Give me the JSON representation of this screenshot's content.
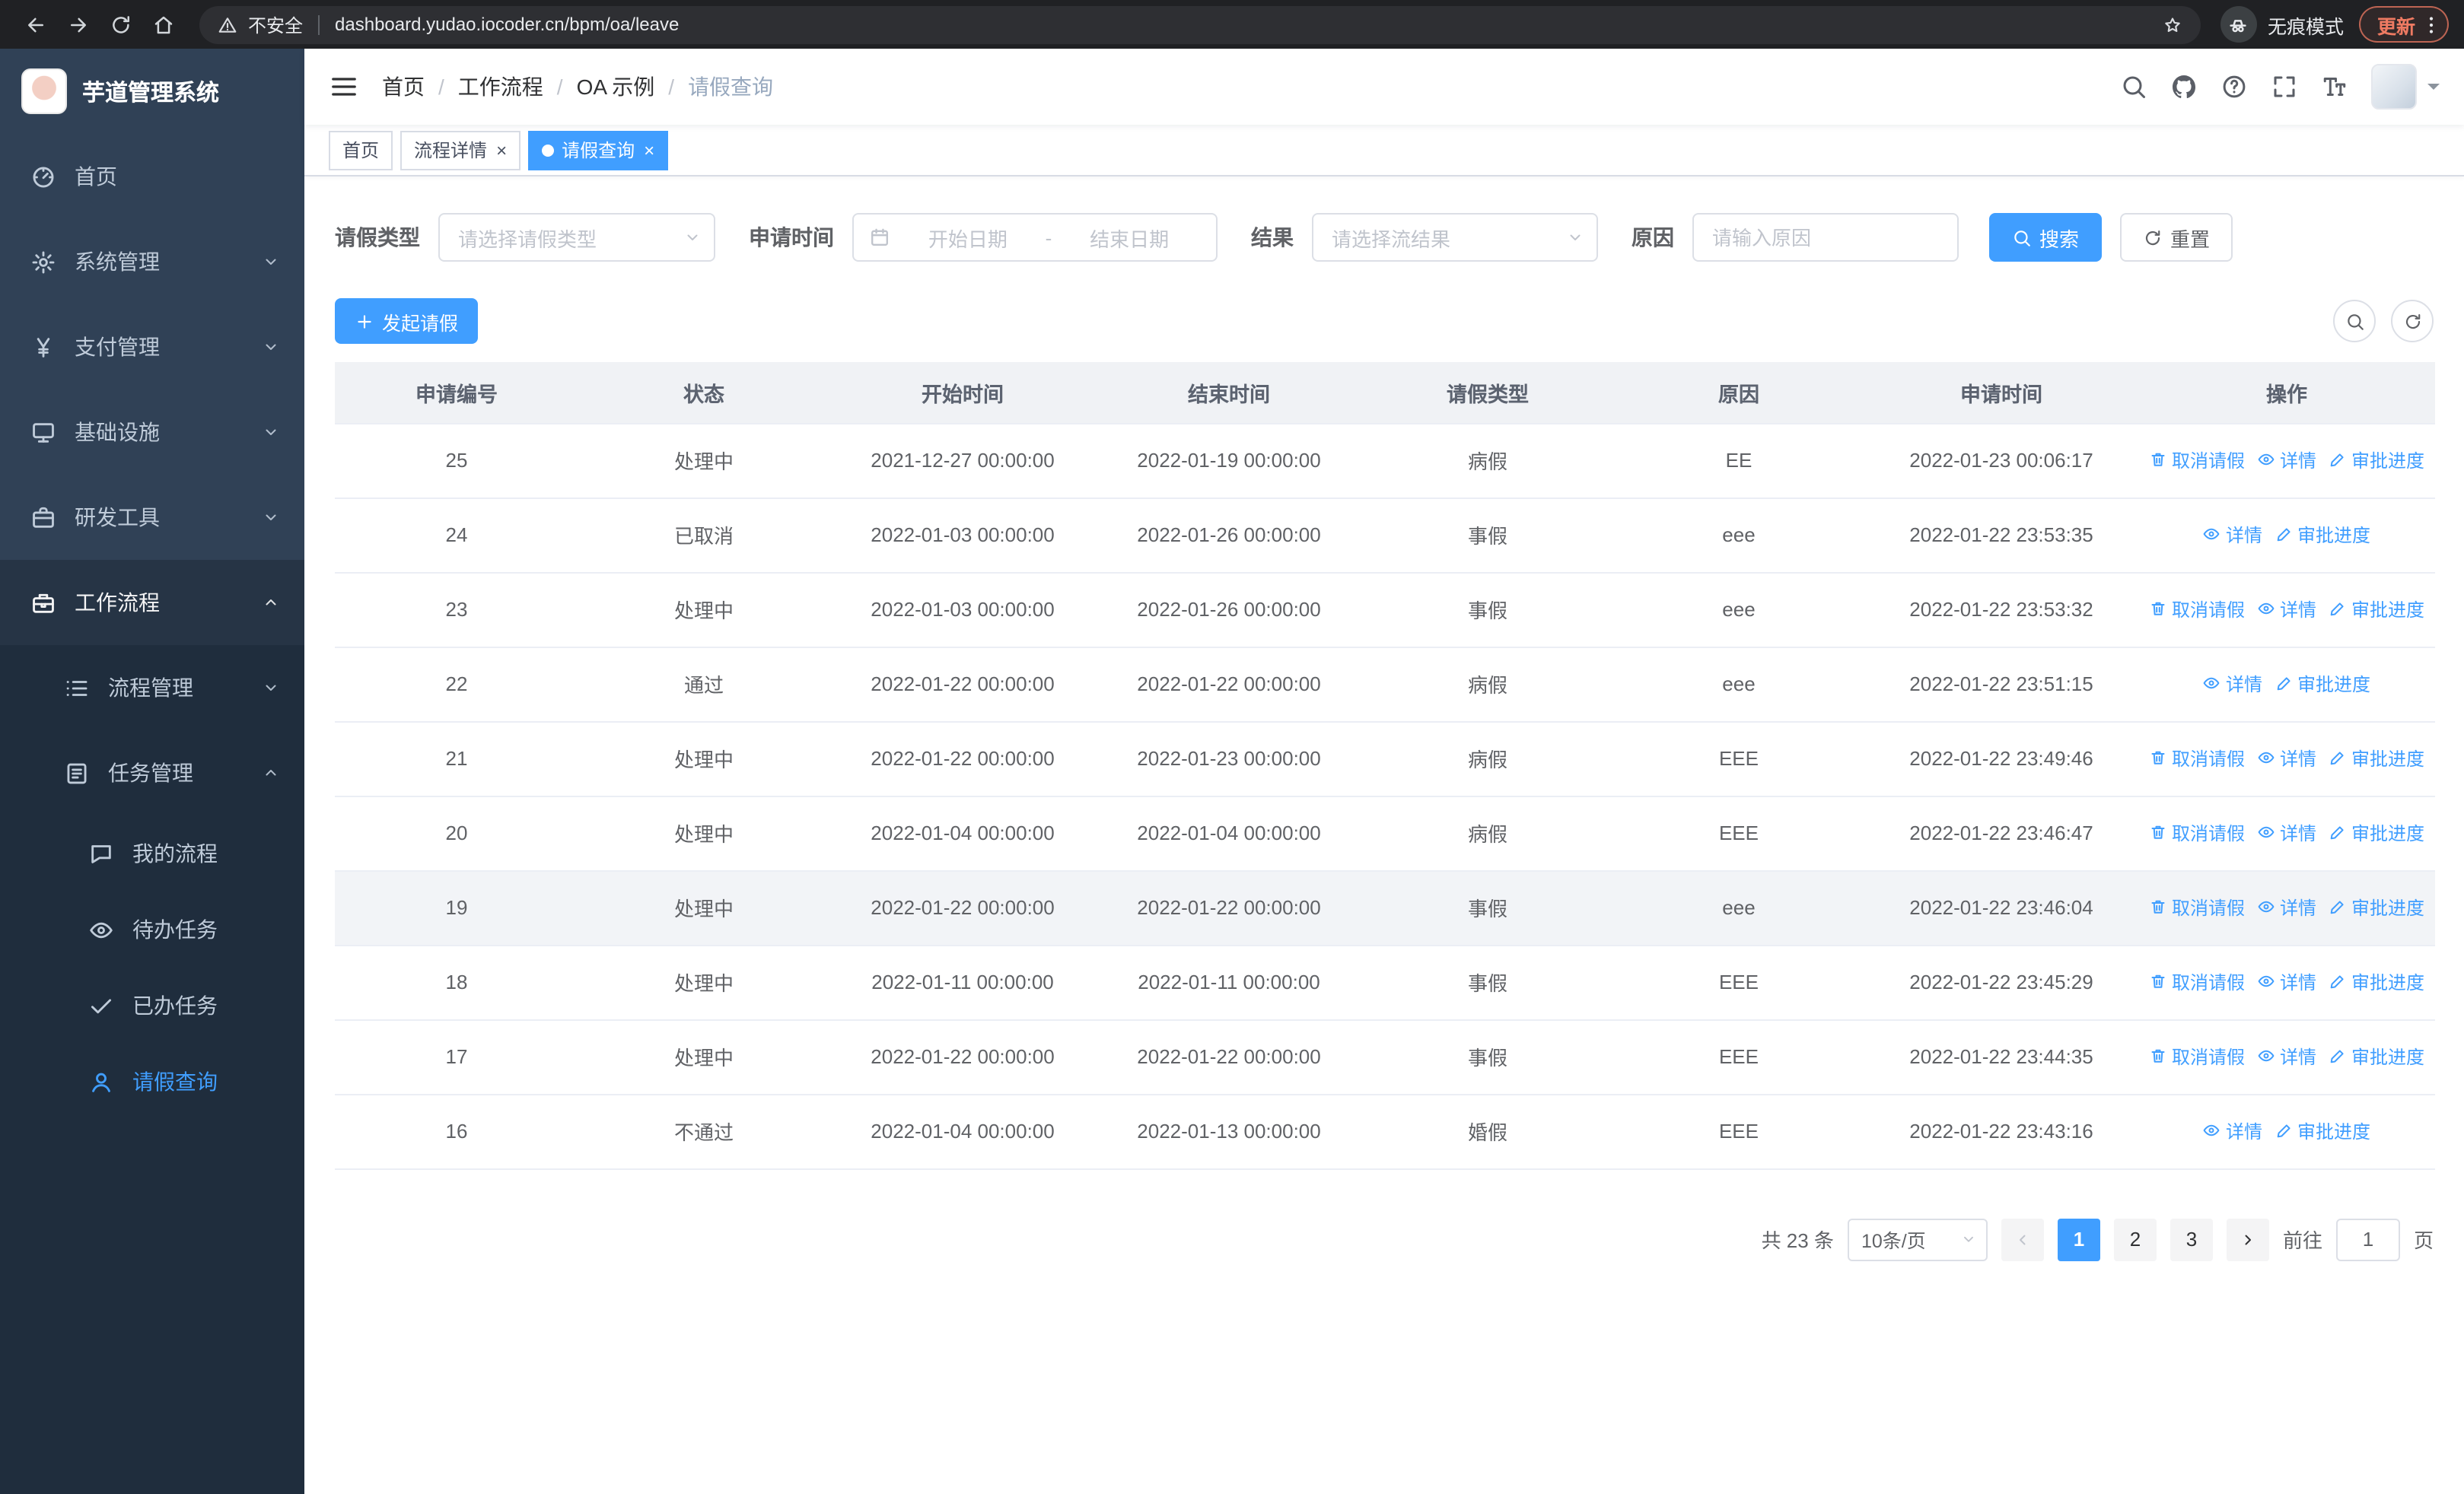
{
  "browser": {
    "security_warning": "不安全",
    "url": "dashboard.yudao.iocoder.cn/bpm/oa/leave",
    "incognito_label": "无痕模式",
    "update_label": "更新"
  },
  "header": {
    "breadcrumb": [
      "首页",
      "工作流程",
      "OA 示例",
      "请假查询"
    ],
    "icons": [
      "search-icon",
      "github-icon",
      "help-icon",
      "fullscreen-icon",
      "font-size-icon"
    ]
  },
  "sidebar": {
    "logo_title": "芋道管理系统",
    "items": [
      {
        "key": "home",
        "label": "首页",
        "icon": "dashboard-icon",
        "level": 0
      },
      {
        "key": "system",
        "label": "系统管理",
        "icon": "gear-icon",
        "level": 0,
        "chevron": "down"
      },
      {
        "key": "payment",
        "label": "支付管理",
        "icon": "yen-icon",
        "level": 0,
        "chevron": "down"
      },
      {
        "key": "infrastructure",
        "label": "基础设施",
        "icon": "infra-icon",
        "level": 0,
        "chevron": "down"
      },
      {
        "key": "devtools",
        "label": "研发工具",
        "icon": "tools-icon",
        "level": 0,
        "chevron": "down"
      },
      {
        "key": "workflow",
        "label": "工作流程",
        "icon": "workflow-icon",
        "level": 0,
        "chevron": "up",
        "open": true
      },
      {
        "key": "process-mgmt",
        "label": "流程管理",
        "icon": "process-icon",
        "level": 1,
        "chevron": "down"
      },
      {
        "key": "task-mgmt",
        "label": "任务管理",
        "icon": "task-icon",
        "level": 1,
        "chevron": "up",
        "open": true
      },
      {
        "key": "my-process",
        "label": "我的流程",
        "icon": "my-process-icon",
        "level": 2
      },
      {
        "key": "todo-tasks",
        "label": "待办任务",
        "icon": "todo-icon",
        "level": 2
      },
      {
        "key": "done-tasks",
        "label": "已办任务",
        "icon": "done-icon",
        "level": 2
      },
      {
        "key": "leave-query",
        "label": "请假查询",
        "icon": "leave-query-icon",
        "level": 2,
        "active": true
      }
    ]
  },
  "tabs": [
    {
      "label": "首页",
      "closable": false,
      "active": false
    },
    {
      "label": "流程详情",
      "closable": true,
      "active": false
    },
    {
      "label": "请假查询",
      "closable": true,
      "active": true
    }
  ],
  "filters": {
    "leave_type_label": "请假类型",
    "leave_type_placeholder": "请选择请假类型",
    "apply_time_label": "申请时间",
    "start_date_placeholder": "开始日期",
    "range_separator": "-",
    "end_date_placeholder": "结束日期",
    "result_label": "结果",
    "result_placeholder": "请选择流结果",
    "reason_label": "原因",
    "reason_placeholder": "请输入原因",
    "search_label": "搜索",
    "reset_label": "重置"
  },
  "toolbar": {
    "create_label": "发起请假"
  },
  "table": {
    "columns": [
      "申请编号",
      "状态",
      "开始时间",
      "结束时间",
      "请假类型",
      "原因",
      "申请时间",
      "操作"
    ],
    "action_labels": {
      "cancel": "取消请假",
      "detail": "详情",
      "progress": "审批进度"
    },
    "rows": [
      {
        "id": "25",
        "status": "处理中",
        "start": "2021-12-27 00:00:00",
        "end": "2022-01-19 00:00:00",
        "type": "病假",
        "reason": "EE",
        "applied": "2022-01-23 00:06:17",
        "actions": [
          "cancel",
          "detail",
          "progress"
        ],
        "highlight": false
      },
      {
        "id": "24",
        "status": "已取消",
        "start": "2022-01-03 00:00:00",
        "end": "2022-01-26 00:00:00",
        "type": "事假",
        "reason": "eee",
        "applied": "2022-01-22 23:53:35",
        "actions": [
          "detail",
          "progress"
        ],
        "highlight": false
      },
      {
        "id": "23",
        "status": "处理中",
        "start": "2022-01-03 00:00:00",
        "end": "2022-01-26 00:00:00",
        "type": "事假",
        "reason": "eee",
        "applied": "2022-01-22 23:53:32",
        "actions": [
          "cancel",
          "detail",
          "progress"
        ],
        "highlight": false
      },
      {
        "id": "22",
        "status": "通过",
        "start": "2022-01-22 00:00:00",
        "end": "2022-01-22 00:00:00",
        "type": "病假",
        "reason": "eee",
        "applied": "2022-01-22 23:51:15",
        "actions": [
          "detail",
          "progress"
        ],
        "highlight": false
      },
      {
        "id": "21",
        "status": "处理中",
        "start": "2022-01-22 00:00:00",
        "end": "2022-01-23 00:00:00",
        "type": "病假",
        "reason": "EEE",
        "applied": "2022-01-22 23:49:46",
        "actions": [
          "cancel",
          "detail",
          "progress"
        ],
        "highlight": false
      },
      {
        "id": "20",
        "status": "处理中",
        "start": "2022-01-04 00:00:00",
        "end": "2022-01-04 00:00:00",
        "type": "病假",
        "reason": "EEE",
        "applied": "2022-01-22 23:46:47",
        "actions": [
          "cancel",
          "detail",
          "progress"
        ],
        "highlight": false
      },
      {
        "id": "19",
        "status": "处理中",
        "start": "2022-01-22 00:00:00",
        "end": "2022-01-22 00:00:00",
        "type": "事假",
        "reason": "eee",
        "applied": "2022-01-22 23:46:04",
        "actions": [
          "cancel",
          "detail",
          "progress"
        ],
        "highlight": true
      },
      {
        "id": "18",
        "status": "处理中",
        "start": "2022-01-11 00:00:00",
        "end": "2022-01-11 00:00:00",
        "type": "事假",
        "reason": "EEE",
        "applied": "2022-01-22 23:45:29",
        "actions": [
          "cancel",
          "detail",
          "progress"
        ],
        "highlight": false
      },
      {
        "id": "17",
        "status": "处理中",
        "start": "2022-01-22 00:00:00",
        "end": "2022-01-22 00:00:00",
        "type": "事假",
        "reason": "EEE",
        "applied": "2022-01-22 23:44:35",
        "actions": [
          "cancel",
          "detail",
          "progress"
        ],
        "highlight": false
      },
      {
        "id": "16",
        "status": "不通过",
        "start": "2022-01-04 00:00:00",
        "end": "2022-01-13 00:00:00",
        "type": "婚假",
        "reason": "EEE",
        "applied": "2022-01-22 23:43:16",
        "actions": [
          "detail",
          "progress"
        ],
        "highlight": false
      }
    ]
  },
  "pagination": {
    "total_text": "共 23 条",
    "page_size": "10条/页",
    "pages": [
      "1",
      "2",
      "3"
    ],
    "active_page": "1",
    "goto_label": "前往",
    "goto_value": "1",
    "page_unit": "页"
  },
  "colors": {
    "accent": "#409eff",
    "sidebar_bg": "#304156",
    "sidebar_sub_bg": "#1f2d3d",
    "update_pill": "#ee7a62",
    "chrome_bg": "#202124"
  }
}
